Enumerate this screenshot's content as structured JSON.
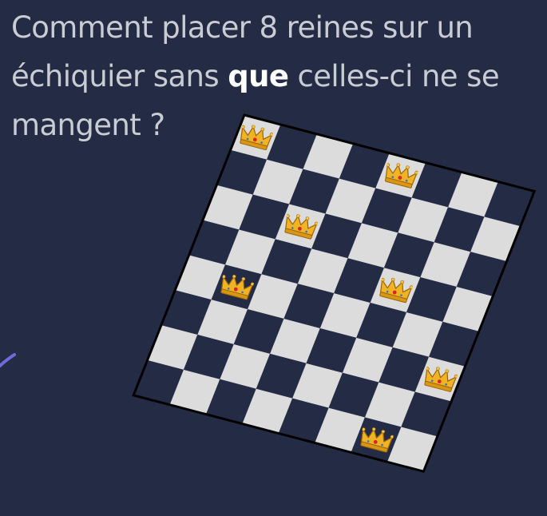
{
  "slide": {
    "title_line1": "Comment placer 8 reines sur un",
    "title_line2_before": "échiquier sans ",
    "title_line2_emph": "que",
    "title_line2_after": " celles-ci ne se",
    "title_line3": "mangent ?"
  },
  "board": {
    "size": 8,
    "light_square_color": "#dcdcdc",
    "dark_square_color": "#242b45",
    "border_color": "#000000",
    "queen_icon": "crown-icon",
    "queen_color": "#e8a317",
    "queens": [
      {
        "row": 0,
        "col": 0
      },
      {
        "row": 0,
        "col": 4
      },
      {
        "row": 2,
        "col": 2
      },
      {
        "row": 3,
        "col": 5
      },
      {
        "row": 4,
        "col": 1
      },
      {
        "row": 5,
        "col": 7
      },
      {
        "row": 7,
        "col": 6
      }
    ]
  },
  "annotation": {
    "pen_color": "#6e6bd8"
  }
}
